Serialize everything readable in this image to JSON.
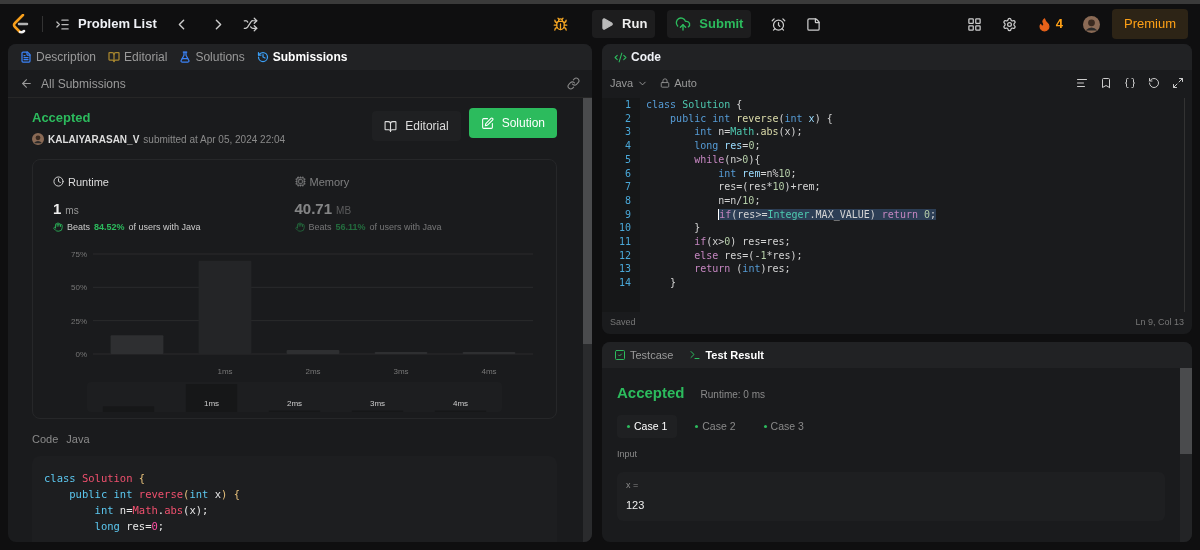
{
  "topbar": {
    "problem_list": "Problem List",
    "run": "Run",
    "submit": "Submit",
    "streak": "4",
    "premium": "Premium"
  },
  "left_tabs": [
    {
      "label": "Description",
      "selected": false
    },
    {
      "label": "Editorial",
      "selected": false
    },
    {
      "label": "Solutions",
      "selected": false
    },
    {
      "label": "Submissions",
      "selected": true
    }
  ],
  "back_link": "All Submissions",
  "submission": {
    "status": "Accepted",
    "user": "KALAIYARASAN_V",
    "submitted": "submitted at Apr 05, 2024 22:04",
    "editorial_button": "Editorial",
    "solution_button": "Solution"
  },
  "metrics": [
    {
      "label": "Runtime",
      "value": "1",
      "unit": "ms",
      "beats": "Beats",
      "percent": "84.52%",
      "rest": "of users with Java",
      "selected": true
    },
    {
      "label": "Memory",
      "value": "40.71",
      "unit": "MB",
      "beats": "Beats",
      "percent": "56.11%",
      "rest": "of users with Java",
      "selected": false
    }
  ],
  "chart_data": {
    "type": "bar",
    "categories": [
      null,
      "1ms",
      "2ms",
      "3ms",
      "4ms"
    ],
    "values": [
      14,
      70,
      3,
      1.5,
      1.5
    ],
    "ylim": [
      0,
      75
    ],
    "grid": true,
    "yticks": [
      {
        "value": 0,
        "label": "0%"
      },
      {
        "value": 25,
        "label": "25%"
      },
      {
        "value": 50,
        "label": "50%"
      },
      {
        "value": 75,
        "label": "75%"
      }
    ]
  },
  "range_labels": [
    "1ms",
    "2ms",
    "3ms",
    "4ms"
  ],
  "code_section": {
    "label": "Code",
    "language": "Java"
  },
  "submitted_code": [
    [
      {
        "text": "class ",
        "kind": "c1"
      },
      {
        "text": "Solution ",
        "kind": "c2"
      },
      {
        "text": "{",
        "kind": "c3"
      }
    ],
    [
      {
        "text": "    public int ",
        "kind": "c1"
      },
      {
        "text": "reverse",
        "kind": "c2"
      },
      {
        "text": "(",
        "kind": "c3"
      },
      {
        "text": "int ",
        "kind": "c1"
      },
      {
        "text": "x",
        "kind": "p"
      },
      {
        "text": ") {",
        "kind": "c3"
      }
    ],
    [
      {
        "text": "        int ",
        "kind": "c1"
      },
      {
        "text": "n=",
        "kind": "p"
      },
      {
        "text": "Math",
        "kind": "c2"
      },
      {
        "text": ".",
        "kind": "p"
      },
      {
        "text": "abs",
        "kind": "c2"
      },
      {
        "text": "(x);",
        "kind": "p"
      }
    ],
    [
      {
        "text": "        long ",
        "kind": "c1"
      },
      {
        "text": "res=",
        "kind": "p"
      },
      {
        "text": "0",
        "kind": "c4"
      },
      {
        "text": ";",
        "kind": "p"
      }
    ]
  ],
  "editor": {
    "title": "Code",
    "language": "Java",
    "mode": "Auto",
    "status": "Saved",
    "cursor": "Ln 9, Col 13",
    "lines": [
      {
        "n": "1",
        "selected": false,
        "tokens": [
          {
            "text": "class ",
            "kind": "kw"
          },
          {
            "text": "Solution ",
            "kind": "type"
          },
          {
            "text": "{",
            "kind": "p"
          }
        ]
      },
      {
        "n": "2",
        "selected": false,
        "tokens": [
          {
            "text": "    public int ",
            "kind": "kw"
          },
          {
            "text": "reverse",
            "kind": "fn"
          },
          {
            "text": "(",
            "kind": "p"
          },
          {
            "text": "int ",
            "kind": "kw"
          },
          {
            "text": "x",
            "kind": "var"
          },
          {
            "text": ") {",
            "kind": "p"
          }
        ]
      },
      {
        "n": "3",
        "selected": false,
        "tokens": [
          {
            "text": "        int ",
            "kind": "kw"
          },
          {
            "text": "n=",
            "kind": "p"
          },
          {
            "text": "Math",
            "kind": "type"
          },
          {
            "text": ".",
            "kind": "p"
          },
          {
            "text": "abs",
            "kind": "fn"
          },
          {
            "text": "(x);",
            "kind": "p"
          }
        ]
      },
      {
        "n": "4",
        "selected": false,
        "tokens": [
          {
            "text": "        long ",
            "kind": "kw"
          },
          {
            "text": "res",
            "kind": "var"
          },
          {
            "text": "=",
            "kind": "p"
          },
          {
            "text": "0",
            "kind": "num"
          },
          {
            "text": ";",
            "kind": "p"
          }
        ]
      },
      {
        "n": "5",
        "selected": false,
        "tokens": [
          {
            "text": "        while",
            "kind": "ctl"
          },
          {
            "text": "(n>",
            "kind": "p"
          },
          {
            "text": "0",
            "kind": "num"
          },
          {
            "text": "){",
            "kind": "p"
          }
        ]
      },
      {
        "n": "6",
        "selected": false,
        "tokens": [
          {
            "text": "            int ",
            "kind": "kw"
          },
          {
            "text": "rem",
            "kind": "var"
          },
          {
            "text": "=n%",
            "kind": "p"
          },
          {
            "text": "10",
            "kind": "num"
          },
          {
            "text": ";",
            "kind": "p"
          }
        ]
      },
      {
        "n": "7",
        "selected": false,
        "tokens": [
          {
            "text": "            res=(res*",
            "kind": "p"
          },
          {
            "text": "10",
            "kind": "num"
          },
          {
            "text": ")+rem;",
            "kind": "p"
          }
        ]
      },
      {
        "n": "8",
        "selected": false,
        "tokens": [
          {
            "text": "            n=n/",
            "kind": "p"
          },
          {
            "text": "10",
            "kind": "num"
          },
          {
            "text": ";",
            "kind": "p"
          }
        ]
      },
      {
        "n": "9",
        "selected": true,
        "tokens": [
          {
            "text": "            if",
            "kind": "ctl"
          },
          {
            "text": "(res>=",
            "kind": "p"
          },
          {
            "text": "Integer",
            "kind": "type"
          },
          {
            "text": ".MAX_VALUE) ",
            "kind": "p"
          },
          {
            "text": "return ",
            "kind": "ctl"
          },
          {
            "text": "0",
            "kind": "num"
          },
          {
            "text": ";",
            "kind": "p"
          }
        ]
      },
      {
        "n": "10",
        "selected": false,
        "tokens": [
          {
            "text": "        }",
            "kind": "p"
          }
        ]
      },
      {
        "n": "11",
        "selected": false,
        "tokens": [
          {
            "text": "        if",
            "kind": "ctl"
          },
          {
            "text": "(x>",
            "kind": "p"
          },
          {
            "text": "0",
            "kind": "num"
          },
          {
            "text": ") res=res;",
            "kind": "p"
          }
        ]
      },
      {
        "n": "12",
        "selected": false,
        "tokens": [
          {
            "text": "        else ",
            "kind": "ctl"
          },
          {
            "text": "res=(-",
            "kind": "p"
          },
          {
            "text": "1",
            "kind": "num"
          },
          {
            "text": "*res);",
            "kind": "p"
          }
        ]
      },
      {
        "n": "13",
        "selected": false,
        "tokens": [
          {
            "text": "        return ",
            "kind": "ctl"
          },
          {
            "text": "(",
            "kind": "p"
          },
          {
            "text": "int",
            "kind": "kw"
          },
          {
            "text": ")res;",
            "kind": "p"
          }
        ]
      },
      {
        "n": "14",
        "selected": false,
        "tokens": [
          {
            "text": "    }",
            "kind": "p"
          }
        ]
      }
    ]
  },
  "bottom_tabs": [
    {
      "label": "Testcase",
      "selected": false
    },
    {
      "label": "Test Result",
      "selected": true
    }
  ],
  "result": {
    "status": "Accepted",
    "runtime": "Runtime: 0 ms"
  },
  "cases": [
    {
      "label": "Case 1",
      "selected": true
    },
    {
      "label": "Case 2",
      "selected": false
    },
    {
      "label": "Case 3",
      "selected": false
    }
  ],
  "input": {
    "label": "Input",
    "name": "x =",
    "value": "123"
  }
}
